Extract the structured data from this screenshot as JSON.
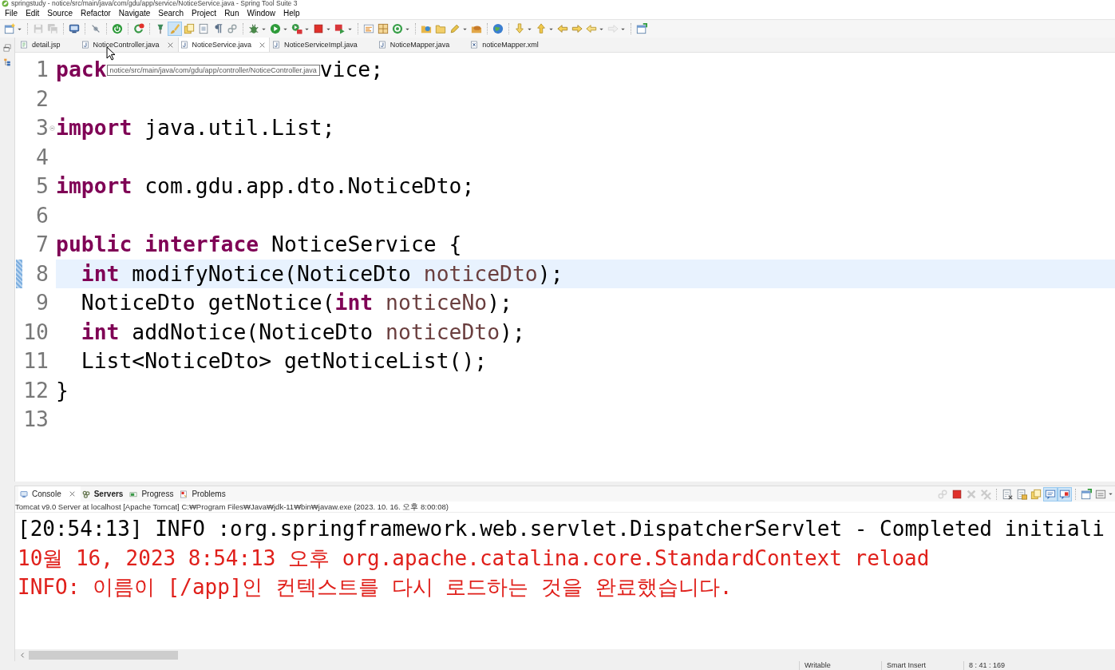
{
  "window": {
    "title": "springstudy - notice/src/main/java/com/gdu/app/service/NoticeService.java - Spring Tool Suite 3"
  },
  "menu": [
    "File",
    "Edit",
    "Source",
    "Refactor",
    "Navigate",
    "Search",
    "Project",
    "Run",
    "Window",
    "Help"
  ],
  "toolbar": [
    [
      {
        "kind": "new_window",
        "dropdown": true,
        "disabled": false,
        "pressed": false
      }
    ],
    [
      {
        "kind": "save",
        "dropdown": false,
        "disabled": true,
        "pressed": false
      },
      {
        "kind": "save_all",
        "dropdown": false,
        "disabled": true,
        "pressed": false
      }
    ],
    [
      {
        "kind": "monitor",
        "dropdown": false,
        "disabled": false,
        "pressed": false
      }
    ],
    [
      {
        "kind": "slash",
        "dropdown": false,
        "disabled": false,
        "pressed": false
      }
    ],
    [
      {
        "kind": "power",
        "dropdown": false,
        "disabled": false,
        "pressed": false
      }
    ],
    [
      {
        "kind": "refresh_badge",
        "dropdown": false,
        "disabled": false,
        "pressed": false
      }
    ],
    [
      {
        "kind": "pin",
        "dropdown": false,
        "disabled": false,
        "pressed": false
      },
      {
        "kind": "brush",
        "dropdown": false,
        "disabled": false,
        "pressed": true
      },
      {
        "kind": "doc_yellow",
        "dropdown": false,
        "disabled": false,
        "pressed": false
      },
      {
        "kind": "block_select",
        "dropdown": false,
        "disabled": false,
        "pressed": false
      },
      {
        "kind": "pilcrow",
        "dropdown": false,
        "disabled": false,
        "pressed": false
      },
      {
        "kind": "link",
        "dropdown": false,
        "disabled": false,
        "pressed": false
      }
    ],
    [
      {
        "kind": "bug",
        "dropdown": true,
        "disabled": false,
        "pressed": false
      },
      {
        "kind": "run",
        "dropdown": true,
        "disabled": false,
        "pressed": false
      },
      {
        "kind": "tools",
        "dropdown": true,
        "disabled": false,
        "pressed": false
      },
      {
        "kind": "stop",
        "dropdown": true,
        "disabled": false,
        "pressed": false
      },
      {
        "kind": "play_box",
        "dropdown": true,
        "disabled": false,
        "pressed": false
      }
    ],
    [
      {
        "kind": "text_lines",
        "dropdown": false,
        "disabled": false,
        "pressed": false
      },
      {
        "kind": "grid",
        "dropdown": false,
        "disabled": false,
        "pressed": false
      },
      {
        "kind": "ring",
        "dropdown": true,
        "disabled": false,
        "pressed": false
      }
    ],
    [
      {
        "kind": "folder_globe",
        "dropdown": false,
        "disabled": false,
        "pressed": false
      },
      {
        "kind": "folder",
        "dropdown": false,
        "disabled": false,
        "pressed": false
      },
      {
        "kind": "pencil",
        "dropdown": true,
        "disabled": false,
        "pressed": false
      },
      {
        "kind": "folder_bowl",
        "dropdown": false,
        "disabled": false,
        "pressed": false
      }
    ],
    [
      {
        "kind": "globe",
        "dropdown": false,
        "disabled": false,
        "pressed": false
      }
    ],
    [
      {
        "kind": "arrow_down",
        "dropdown": true,
        "disabled": false,
        "pressed": false
      },
      {
        "kind": "arrow_up",
        "dropdown": true,
        "disabled": false,
        "pressed": false
      },
      {
        "kind": "back",
        "dropdown": false,
        "disabled": false,
        "pressed": false
      },
      {
        "kind": "forward",
        "dropdown": false,
        "disabled": false,
        "pressed": false
      },
      {
        "kind": "left",
        "dropdown": true,
        "disabled": false,
        "pressed": false
      },
      {
        "kind": "right",
        "dropdown": true,
        "disabled": true,
        "pressed": false
      }
    ],
    [
      {
        "kind": "window",
        "dropdown": false,
        "disabled": false,
        "pressed": false
      }
    ]
  ],
  "editor": {
    "tabs": [
      {
        "label": "detail.jsp",
        "kind": "jsp",
        "selected": false,
        "hovered": false
      },
      {
        "label": "NoticeController.java",
        "kind": "java",
        "selected": false,
        "hovered": true
      },
      {
        "label": "NoticeService.java",
        "kind": "java",
        "selected": true,
        "hovered": false
      },
      {
        "label": "NoticeServiceImpl.java",
        "kind": "java",
        "selected": false,
        "hovered": false
      },
      {
        "label": "NoticeMapper.java",
        "kind": "java",
        "selected": false,
        "hovered": false
      },
      {
        "label": "noticeMapper.xml",
        "kind": "xml",
        "selected": false,
        "hovered": false
      }
    ],
    "lines": [
      {
        "number": "1",
        "current": false,
        "changed": false,
        "tokens": [
          {
            "kind": "keyword",
            "text": "pack"
          },
          {
            "kind": "tooltip",
            "text": "notice/src/main/java/com/gdu/app/controller/NoticeController.java"
          },
          {
            "kind": "plain",
            "text": "vice;"
          }
        ]
      },
      {
        "number": "2",
        "current": false,
        "changed": false
      },
      {
        "number": "3",
        "current": false,
        "changed": false,
        "fold": {
          "expanded": true
        },
        "tokens": [
          {
            "kind": "keyword",
            "text": "import"
          },
          {
            "kind": "plain",
            "text": " java.util.List;"
          }
        ]
      },
      {
        "number": "4",
        "current": false,
        "changed": false
      },
      {
        "number": "5",
        "current": false,
        "changed": false,
        "tokens": [
          {
            "kind": "keyword",
            "text": "import"
          },
          {
            "kind": "plain",
            "text": " com.gdu.app.dto.NoticeDto;"
          }
        ]
      },
      {
        "number": "6",
        "current": false,
        "changed": false
      },
      {
        "number": "7",
        "current": false,
        "changed": false,
        "tokens": [
          {
            "kind": "keyword",
            "text": "public interface"
          },
          {
            "kind": "plain",
            "text": " NoticeService {"
          }
        ],
        "children": [
          {
            "number": "8",
            "current": true,
            "changed": true,
            "tokens": [
              {
                "kind": "keyword",
                "text": "int"
              },
              {
                "kind": "plain",
                "text": " modifyNotice(NoticeDto"
              },
              {
                "kind": "param",
                "text": " noticeDto"
              },
              {
                "kind": "plain",
                "text": ");"
              }
            ]
          },
          {
            "number": "9",
            "current": false,
            "changed": false,
            "tokens": [
              {
                "kind": "plain",
                "text": "NoticeDto getNotice("
              },
              {
                "kind": "keyword",
                "text": "int"
              },
              {
                "kind": "param",
                "text": " noticeNo"
              },
              {
                "kind": "plain",
                "text": ");"
              }
            ]
          },
          {
            "number": "10",
            "current": false,
            "changed": false,
            "tokens": [
              {
                "kind": "keyword",
                "text": "int"
              },
              {
                "kind": "plain",
                "text": " addNotice(NoticeDto"
              },
              {
                "kind": "param",
                "text": " noticeDto"
              },
              {
                "kind": "plain",
                "text": ");"
              }
            ]
          },
          {
            "number": "11",
            "current": false,
            "changed": false,
            "tokens": [
              {
                "kind": "plain",
                "text": "List<NoticeDto> getNoticeList();"
              }
            ]
          }
        ]
      },
      {
        "number": "12",
        "current": false,
        "changed": false,
        "tokens": [
          {
            "kind": "plain",
            "text": "}"
          }
        ]
      },
      {
        "number": "13",
        "current": false,
        "changed": false
      }
    ]
  },
  "console": {
    "tabs": [
      {
        "label": "Console",
        "kind": "console",
        "selected": true,
        "highlighted": false
      },
      {
        "label": "Servers",
        "kind": "servers",
        "selected": false,
        "highlighted": true
      },
      {
        "label": "Progress",
        "kind": "progress",
        "selected": false,
        "highlighted": false
      },
      {
        "label": "Problems",
        "kind": "problems",
        "selected": false,
        "highlighted": false
      }
    ],
    "toolbar": [
      [
        {
          "kind": "link",
          "dropdown": false,
          "disabled": true,
          "pressed": false
        },
        {
          "kind": "stop",
          "dropdown": false,
          "disabled": false,
          "pressed": false
        },
        {
          "kind": "remove",
          "dropdown": false,
          "disabled": true,
          "pressed": false
        },
        {
          "kind": "remove_all",
          "dropdown": false,
          "disabled": true,
          "pressed": false
        }
      ],
      [
        {
          "kind": "clear",
          "dropdown": false,
          "disabled": false,
          "pressed": false
        },
        {
          "kind": "lock",
          "dropdown": false,
          "disabled": false,
          "pressed": false
        },
        {
          "kind": "doc_yellow",
          "dropdown": false,
          "disabled": false,
          "pressed": false
        },
        {
          "kind": "message_out",
          "dropdown": false,
          "disabled": false,
          "pressed": true
        },
        {
          "kind": "message_err",
          "dropdown": false,
          "disabled": false,
          "pressed": true
        }
      ],
      [
        {
          "kind": "window",
          "dropdown": false,
          "disabled": false,
          "pressed": false
        },
        {
          "kind": "panel",
          "dropdown": true,
          "disabled": false,
          "pressed": false
        }
      ]
    ],
    "description": "Tomcat v9.0 Server at localhost [Apache Tomcat] C:₩Program Files₩Java₩jdk-11₩bin₩javaw.exe  (2023. 10. 16. 오후 8:00:08)",
    "lines": [
      {
        "kind": "stdout",
        "text": "[20:54:13] INFO :org.springframework.web.servlet.DispatcherServlet - Completed initiali"
      },
      {
        "kind": "stderr",
        "text": "10월 16, 2023 8:54:13 오후 org.apache.catalina.core.StandardContext reload"
      },
      {
        "kind": "stderr",
        "text": "INFO: 이름이 [/app]인 컨텍스트를 다시 로드하는 것을 완료했습니다."
      }
    ]
  },
  "status_bar": {
    "fields": [
      "Writable",
      "Smart Insert",
      "8 : 41 : 169"
    ]
  }
}
